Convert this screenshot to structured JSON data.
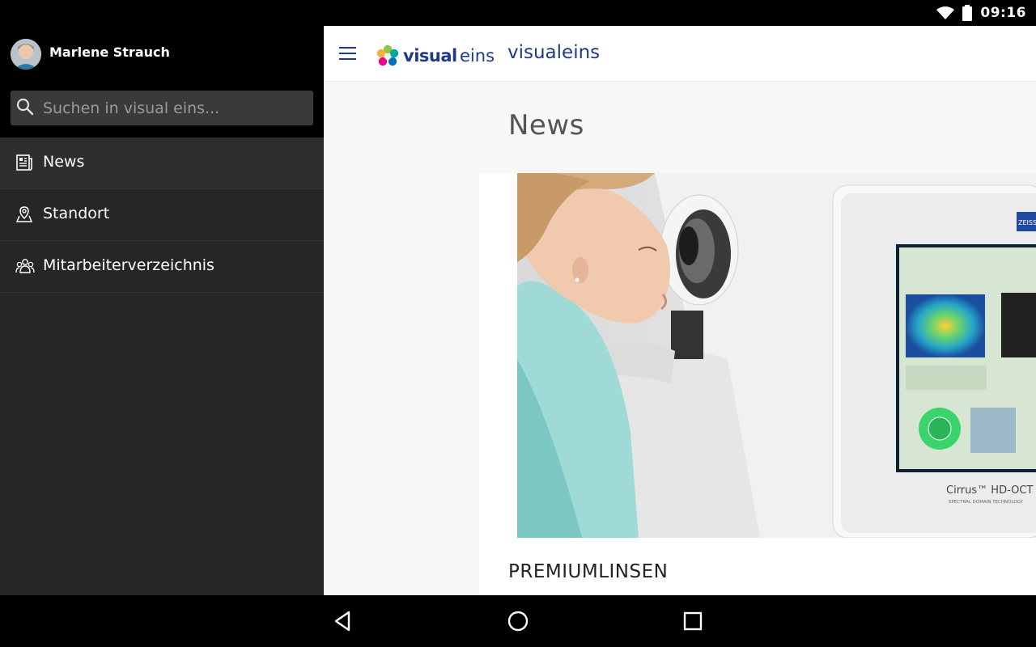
{
  "status_bar": {
    "time": "09:16",
    "icons": [
      "wifi-icon",
      "battery-icon"
    ]
  },
  "drawer": {
    "user_name": "Marlene Strauch",
    "search": {
      "placeholder": "Suchen in visual eins...",
      "value": ""
    },
    "items": [
      {
        "label": "News",
        "icon": "news-icon",
        "active": true
      },
      {
        "label": "Standort",
        "icon": "location-icon",
        "active": false
      },
      {
        "label": "Mitarbeiterverzeichnis",
        "icon": "people-icon",
        "active": false
      }
    ]
  },
  "appbar": {
    "logo_text_primary": "visual",
    "logo_text_secondary": "eins",
    "brand_name": "visualeins"
  },
  "main": {
    "page_title": "News",
    "card": {
      "title": "PREMIUMLINSEN",
      "image_text": {
        "device_name": "Cirrus™ HD-OCT",
        "device_sub": "SPECTRAL DOMAIN TECHNOLOGY",
        "brand": "ZEISS"
      }
    }
  },
  "colors": {
    "drawer_bg": "#262626",
    "header_bg": "#000000",
    "brand_blue": "#1f3a8a"
  },
  "nav_bar": {
    "buttons": [
      "back-icon",
      "home-icon",
      "recents-icon"
    ]
  }
}
